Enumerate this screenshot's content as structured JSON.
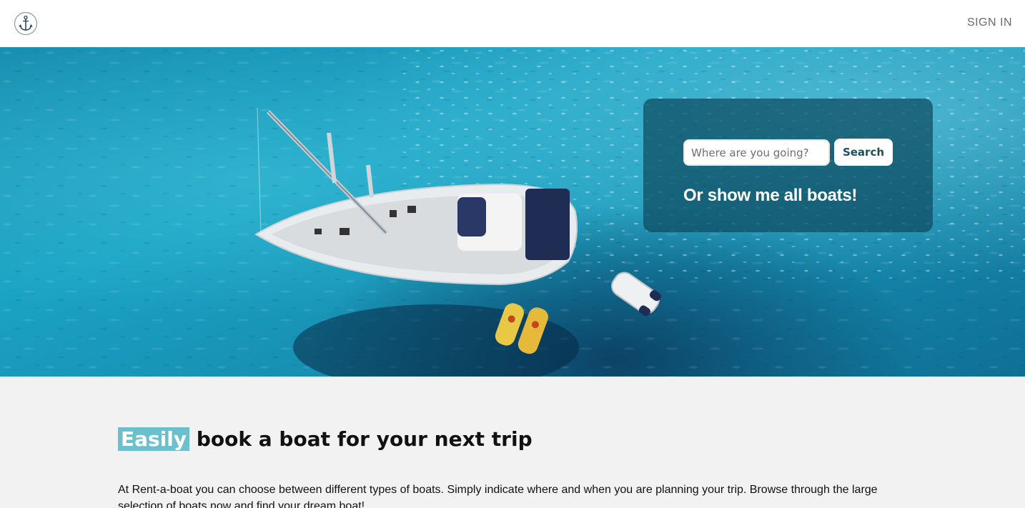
{
  "header": {
    "logo_icon": "anchor-icon",
    "signin_label": "SIGN IN"
  },
  "hero": {
    "background_image": "aerial view of sailing boat on turquoise water",
    "search": {
      "placeholder": "Where are you going?",
      "value": "",
      "button_label": "Search"
    },
    "show_all_label": "Or show me all boats!"
  },
  "content": {
    "headline_highlight": "Easily",
    "headline_rest": " book a boat for your next trip",
    "intro_text": "At Rent-a-boat you can choose between different types of boats. Simply indicate where and when you are planning your trip. Browse through the large selection of boats now and find your dream boat!"
  },
  "colors": {
    "header_bg": "#ffffff",
    "panel_bg": "#0c4b5f",
    "highlight": "#6cbfcc",
    "button_text": "#1c4f5f",
    "page_bg": "#f2f2f2"
  }
}
